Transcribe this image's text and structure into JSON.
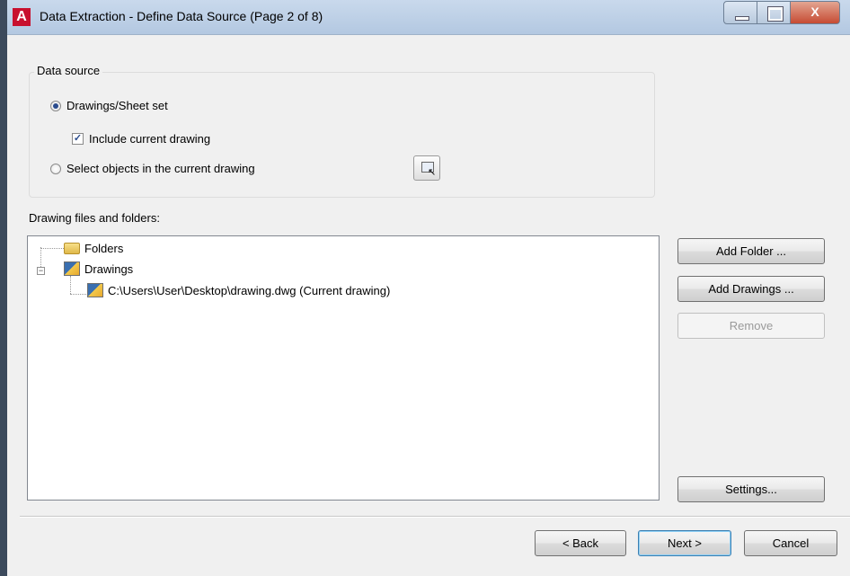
{
  "window": {
    "title": "Data Extraction - Define Data Source (Page 2 of 8)",
    "app_icon_letter": "A",
    "close_glyph": "X"
  },
  "data_source": {
    "group_label": "Data source",
    "option_drawings": "Drawings/Sheet set",
    "include_current": "Include current drawing",
    "include_current_checked": true,
    "option_select": "Select objects in the current drawing",
    "selected_option": "drawings"
  },
  "files": {
    "section_label": "Drawing files and folders:",
    "tree": {
      "folders_label": "Folders",
      "drawings_label": "Drawings",
      "drawing_item": "C:\\Users\\User\\Desktop\\drawing.dwg (Current drawing)"
    }
  },
  "side_buttons": {
    "add_folder": "Add Folder ...",
    "add_drawings": "Add Drawings ...",
    "remove": "Remove",
    "settings": "Settings..."
  },
  "footer": {
    "back": "< Back",
    "next": "Next >",
    "cancel": "Cancel"
  },
  "colors": {
    "title_bar": "#b3c8e1",
    "accent": "#2a4b8d",
    "close_button": "#c64b33"
  }
}
